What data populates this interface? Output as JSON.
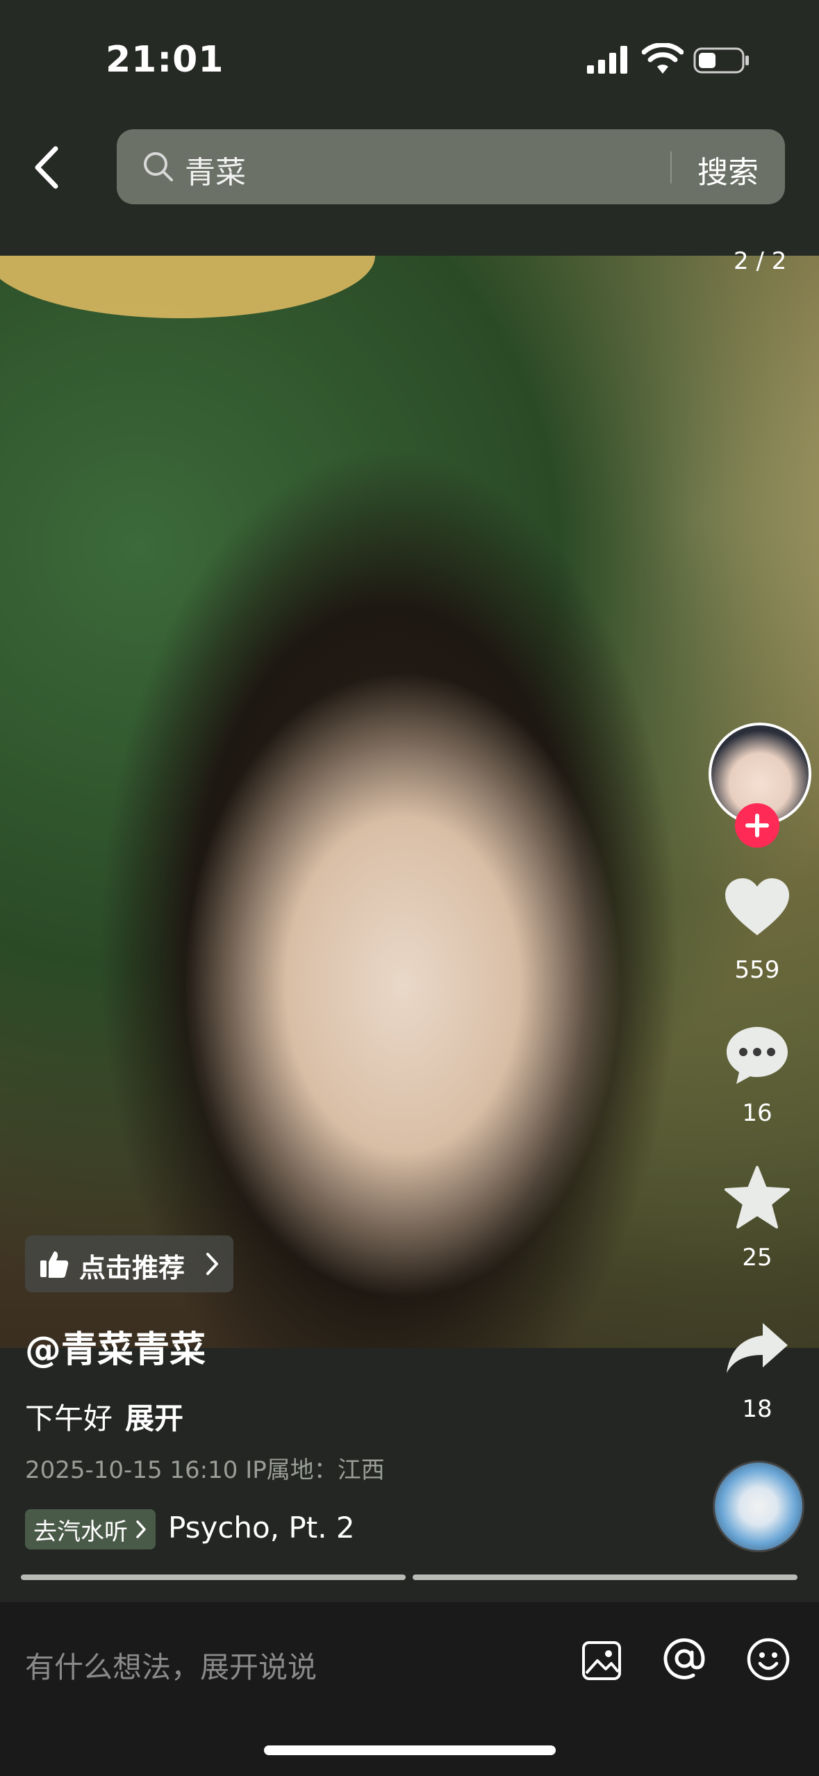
{
  "status_bar": {
    "time": "21:01"
  },
  "search": {
    "query": "青菜",
    "button_label": "搜索"
  },
  "post": {
    "page_indicator": "2 / 2",
    "recommend_label": "点击推荐",
    "author": "@青菜青菜",
    "description": "下午好",
    "expand_label": "展开",
    "meta": "2025-10-15 16:10  IP属地：江西",
    "music_tag_label": "去汽水听",
    "music_title": "Psycho, Pt. 2"
  },
  "actions": {
    "likes": "559",
    "comments": "16",
    "favorites": "25",
    "shares": "18"
  },
  "comment_bar": {
    "placeholder": "有什么想法，展开说说"
  },
  "colors": {
    "follow": "#ff2a55",
    "search_bg": "#6b7166",
    "music_tag_bg": "#4a5a48"
  }
}
